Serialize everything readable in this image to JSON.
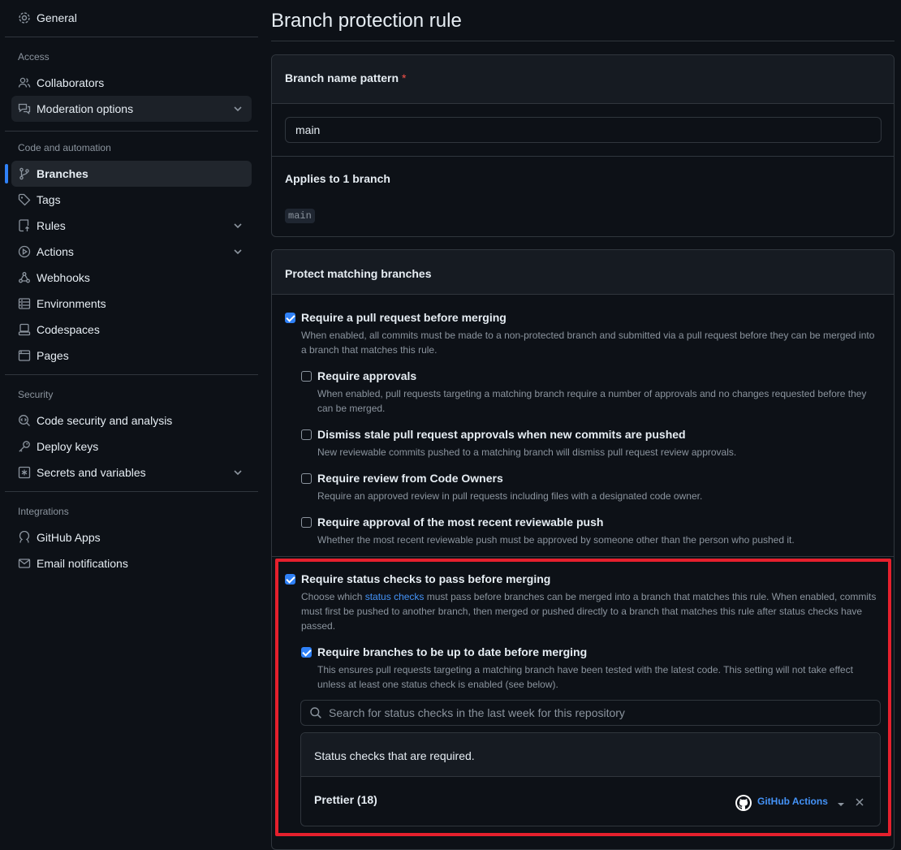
{
  "sidebar": {
    "general": "General",
    "sections": {
      "access": "Access",
      "code_automation": "Code and automation",
      "security": "Security",
      "integrations": "Integrations"
    },
    "items": {
      "collaborators": "Collaborators",
      "moderation": "Moderation options",
      "branches": "Branches",
      "tags": "Tags",
      "rules": "Rules",
      "actions": "Actions",
      "webhooks": "Webhooks",
      "environments": "Environments",
      "codespaces": "Codespaces",
      "pages": "Pages",
      "code_security": "Code security and analysis",
      "deploy_keys": "Deploy keys",
      "secrets": "Secrets and variables",
      "github_apps": "GitHub Apps",
      "email_notifications": "Email notifications"
    }
  },
  "page": {
    "title": "Branch protection rule"
  },
  "pattern_box": {
    "label": "Branch name pattern",
    "required_mark": "*",
    "value": "main",
    "applies_label": "Applies to 1 branch",
    "branch_chip": "main"
  },
  "protect_box": {
    "header": "Protect matching branches",
    "options": {
      "require_pr": {
        "title": "Require a pull request before merging",
        "desc": "When enabled, all commits must be made to a non-protected branch and submitted via a pull request before they can be merged into a branch that matches this rule.",
        "checked": true
      },
      "require_approvals": {
        "title": "Require approvals",
        "desc": "When enabled, pull requests targeting a matching branch require a number of approvals and no changes requested before they can be merged.",
        "checked": false
      },
      "dismiss_stale": {
        "title": "Dismiss stale pull request approvals when new commits are pushed",
        "desc": "New reviewable commits pushed to a matching branch will dismiss pull request review approvals.",
        "checked": false
      },
      "code_owners": {
        "title": "Require review from Code Owners",
        "desc": "Require an approved review in pull requests including files with a designated code owner.",
        "checked": false
      },
      "recent_push": {
        "title": "Require approval of the most recent reviewable push",
        "desc": "Whether the most recent reviewable push must be approved by someone other than the person who pushed it.",
        "checked": false
      },
      "status_checks": {
        "title": "Require status checks to pass before merging",
        "desc_pre": "Choose which ",
        "desc_link": "status checks",
        "desc_post": " must pass before branches can be merged into a branch that matches this rule. When enabled, commits must first be pushed to another branch, then merged or pushed directly to a branch that matches this rule after status checks have passed.",
        "checked": true
      },
      "up_to_date": {
        "title": "Require branches to be up to date before merging",
        "desc": "This ensures pull requests targeting a matching branch have been tested with the latest code. This setting will not take effect unless at least one status check is enabled (see below).",
        "checked": true
      }
    },
    "search_placeholder": "Search for status checks in the last week for this repository",
    "checks_header": "Status checks that are required.",
    "check_item": {
      "name": "Prettier (18)",
      "source": "GitHub Actions"
    }
  },
  "colors": {
    "accent": "#2f81f7",
    "highlight_border": "#e5202d"
  }
}
